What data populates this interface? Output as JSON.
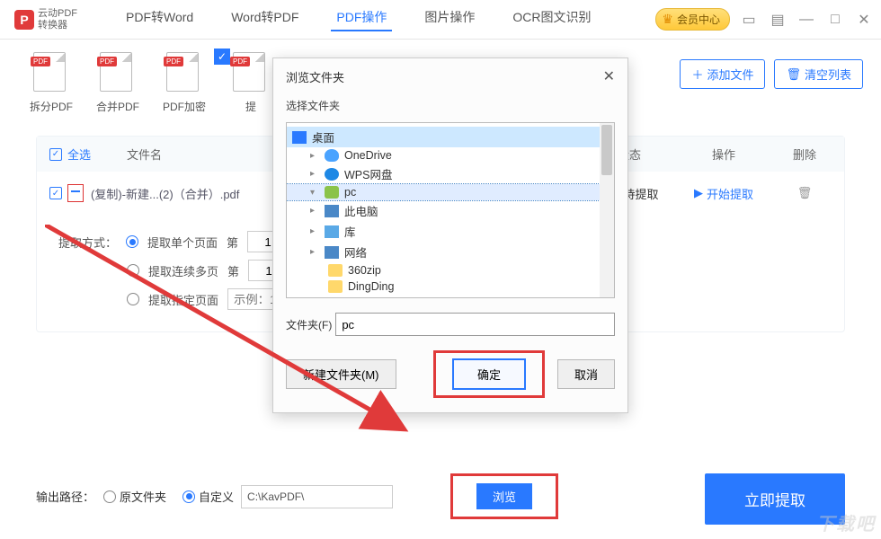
{
  "app": {
    "name_line1": "云动PDF",
    "name_line2": "转换器"
  },
  "nav": {
    "pdf2word": "PDF转Word",
    "word2pdf": "Word转PDF",
    "pdfops": "PDF操作",
    "imgops": "图片操作",
    "ocr": "OCR图文识别"
  },
  "vip": {
    "label": "会员中心",
    "tag": "VIP"
  },
  "tools": {
    "split": "拆分PDF",
    "merge": "合并PDF",
    "encrypt": "PDF加密",
    "extract_prefix": "提",
    "pdf_tag": "PDF"
  },
  "actions": {
    "add_file": "添加文件",
    "clear_list": "清空列表"
  },
  "table": {
    "select_all": "全选",
    "col_name": "文件名",
    "col_status": "状态",
    "col_op": "操作",
    "col_del": "删除",
    "row_file": "(复制)-新建...(2)（合并）.pdf",
    "row_status": "文件待提取",
    "row_action": "开始提取"
  },
  "opts": {
    "label": "提取方式：",
    "single": "提取单个页面",
    "multi": "提取连续多页",
    "spec": "提取指定页面",
    "page_word": "第",
    "page_val": "1",
    "example_ph": "示例：1-5"
  },
  "footer": {
    "out_label": "输出路径：",
    "orig": "原文件夹",
    "custom": "自定义",
    "path": "C:\\KavPDF\\",
    "browse": "浏览",
    "go": "立即提取"
  },
  "dialog": {
    "title": "浏览文件夹",
    "subtitle": "选择文件夹",
    "nodes": {
      "desktop": "桌面",
      "onedrive": "OneDrive",
      "wps": "WPS网盘",
      "pc_user": "pc",
      "this_pc": "此电脑",
      "lib": "库",
      "network": "网络",
      "zip": "360zip",
      "dingding": "DingDing"
    },
    "field_label": "文件夹(F)",
    "field_value": "pc",
    "new_folder": "新建文件夹(M)",
    "ok": "确定",
    "cancel": "取消"
  },
  "watermark": "下载吧"
}
